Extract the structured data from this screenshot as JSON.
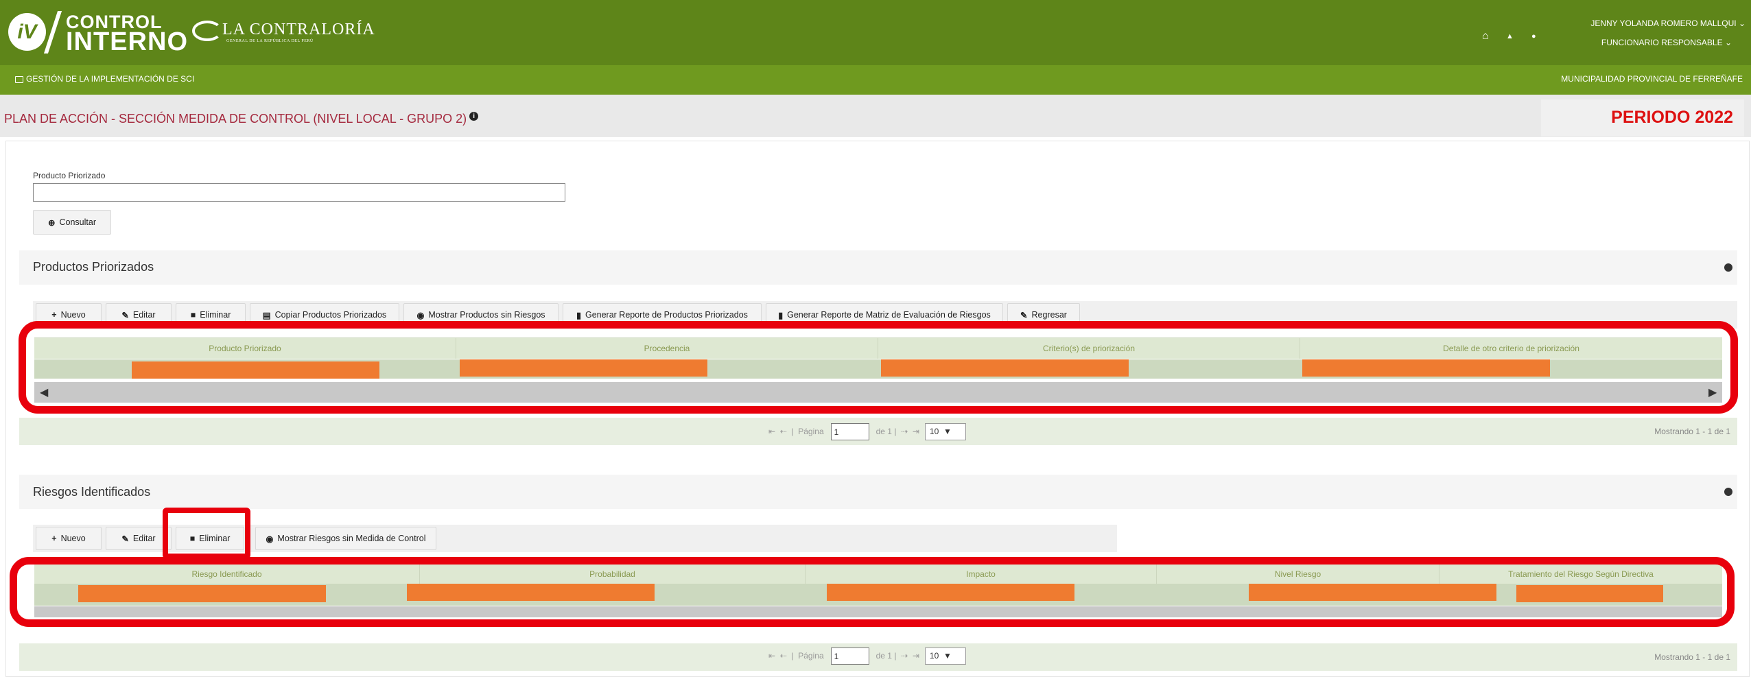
{
  "header": {
    "logo_mark": "iV",
    "brand_top": "CONTROL",
    "brand_bottom": "INTERNO",
    "org_name": "LA CONTRALORÍA",
    "org_sub": "GENERAL DE LA REPÚBLICA DEL PERÚ",
    "user_name": "JENNY YOLANDA ROMERO MALLQUI",
    "user_role": "FUNCIONARIO RESPONSABLE",
    "home_icon": "⌂",
    "bell_icon": "▲",
    "user_icon": "●",
    "caret": "⌄"
  },
  "subbar": {
    "left_label": "GESTIÓN DE LA IMPLEMENTACIÓN DE SCI",
    "right_label": "MUNICIPALIDAD PROVINCIAL DE FERREÑAFE"
  },
  "page": {
    "title": "PLAN DE ACCIÓN - SECCIÓN MEDIDA DE CONTROL (NIVEL LOCAL - GRUPO 2)",
    "info": "i",
    "periodo": "PERIODO 2022"
  },
  "search": {
    "label": "Producto Priorizado",
    "value": "",
    "button": "Consultar",
    "button_icon": "⊕"
  },
  "productos": {
    "title": "Productos Priorizados",
    "toolbar": [
      {
        "icon": "+",
        "label": "Nuevo"
      },
      {
        "icon": "✎",
        "label": "Editar"
      },
      {
        "icon": "■",
        "label": "Eliminar"
      },
      {
        "icon": "▤",
        "label": "Copiar Productos Priorizados"
      },
      {
        "icon": "◉",
        "label": "Mostrar Productos sin Riesgos"
      },
      {
        "icon": "▮",
        "label": "Generar Reporte de Productos Priorizados"
      },
      {
        "icon": "▮",
        "label": "Generar Reporte de Matriz de Evaluación de Riesgos"
      },
      {
        "icon": "✎",
        "label": "Regresar"
      }
    ],
    "columns": [
      "Producto Priorizado",
      "Procedencia",
      "Criterio(s) de priorización",
      "Detalle de otro criterio de priorización"
    ],
    "scroll_left": "◀",
    "scroll_right": "▶"
  },
  "riesgos": {
    "title": "Riesgos Identificados",
    "toolbar": [
      {
        "icon": "+",
        "label": "Nuevo"
      },
      {
        "icon": "✎",
        "label": "Editar"
      },
      {
        "icon": "■",
        "label": "Eliminar"
      },
      {
        "icon": "◉",
        "label": "Mostrar Riesgos sin Medida de Control"
      }
    ],
    "columns": [
      "Riesgo Identificado",
      "Probabilidad",
      "Impacto",
      "Nivel Riesgo",
      "Tratamiento del Riesgo Según Directiva"
    ]
  },
  "pager": {
    "first": "⇤",
    "prev": "⇠",
    "page_label": "Página",
    "page_value": "1",
    "of_label": "de 1",
    "next": "⇢",
    "last": "⇥",
    "page_size": "10",
    "select_arrow": "▼",
    "showing": "Mostrando 1 - 1 de 1"
  }
}
